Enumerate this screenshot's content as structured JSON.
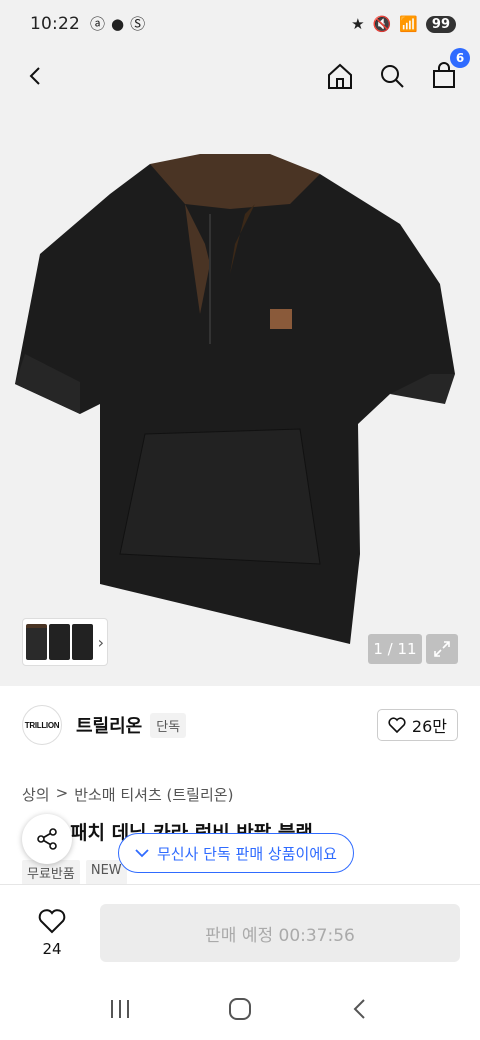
{
  "status": {
    "time": "10:22",
    "battery": "99"
  },
  "header": {
    "cart_count": "6"
  },
  "gallery": {
    "counter": "1 / 11"
  },
  "brand": {
    "logo_text": "TRILLION",
    "name": "트릴리온",
    "tag": "단독",
    "likes": "26만"
  },
  "breadcrumb": {
    "category": "상의",
    "separator": ">",
    "subcategory": "반소매 티셔츠 (트릴리온)"
  },
  "product": {
    "title": "패치 데님 카라 럭비 반팔 블랙"
  },
  "tags": [
    "무료반품",
    "NEW"
  ],
  "toast": {
    "text": "무신사 단독 판매 상품이에요"
  },
  "bottom": {
    "wish_count": "24",
    "buy_label": "판매 예정 00:37:56"
  },
  "colors": {
    "accent": "#2f6bff",
    "shirt": "#1c1c1c",
    "collar": "#4a3424"
  }
}
